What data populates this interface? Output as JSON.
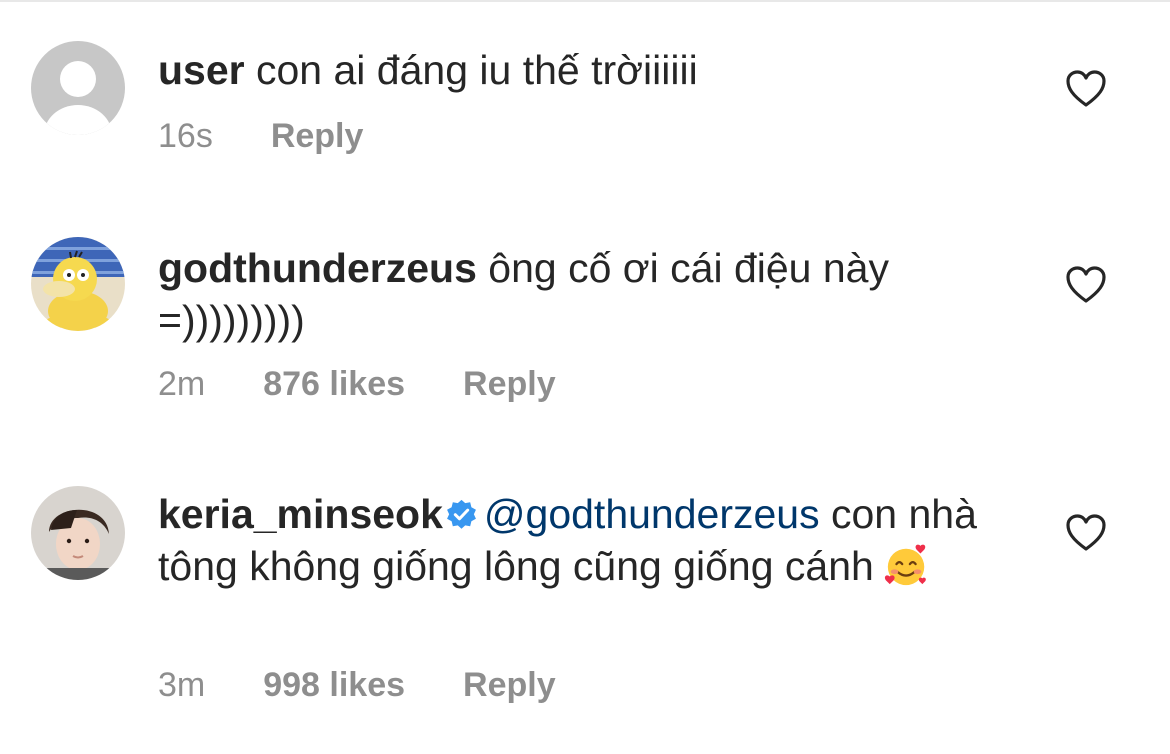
{
  "comments": [
    {
      "username": "user",
      "text": " con ai đáng iu thế trờiiiiii",
      "time": "16s",
      "reply_label": "Reply",
      "avatar": "default-avatar"
    },
    {
      "username": "godthunderzeus",
      "text": " ông cố ơi cái điệu này =)))))))))",
      "time": "2m",
      "likes": "876 likes",
      "reply_label": "Reply",
      "avatar": "psyduck-avatar"
    },
    {
      "username": "keria_minseok",
      "verified": true,
      "mention": "@godthunderzeus",
      "text": " con nhà tông không giống lông cũng giống cánh",
      "emoji": "smiling-face-with-hearts",
      "time": "3m",
      "likes": "998 likes",
      "reply_label": "Reply",
      "avatar": "profile-photo-avatar"
    }
  ],
  "icons": {
    "like": "heart-outline-icon",
    "verified": "verified-badge-icon"
  },
  "colors": {
    "text": "#262626",
    "meta": "#8e8e8e",
    "mention": "#00376b",
    "verified": "#3897f0"
  }
}
